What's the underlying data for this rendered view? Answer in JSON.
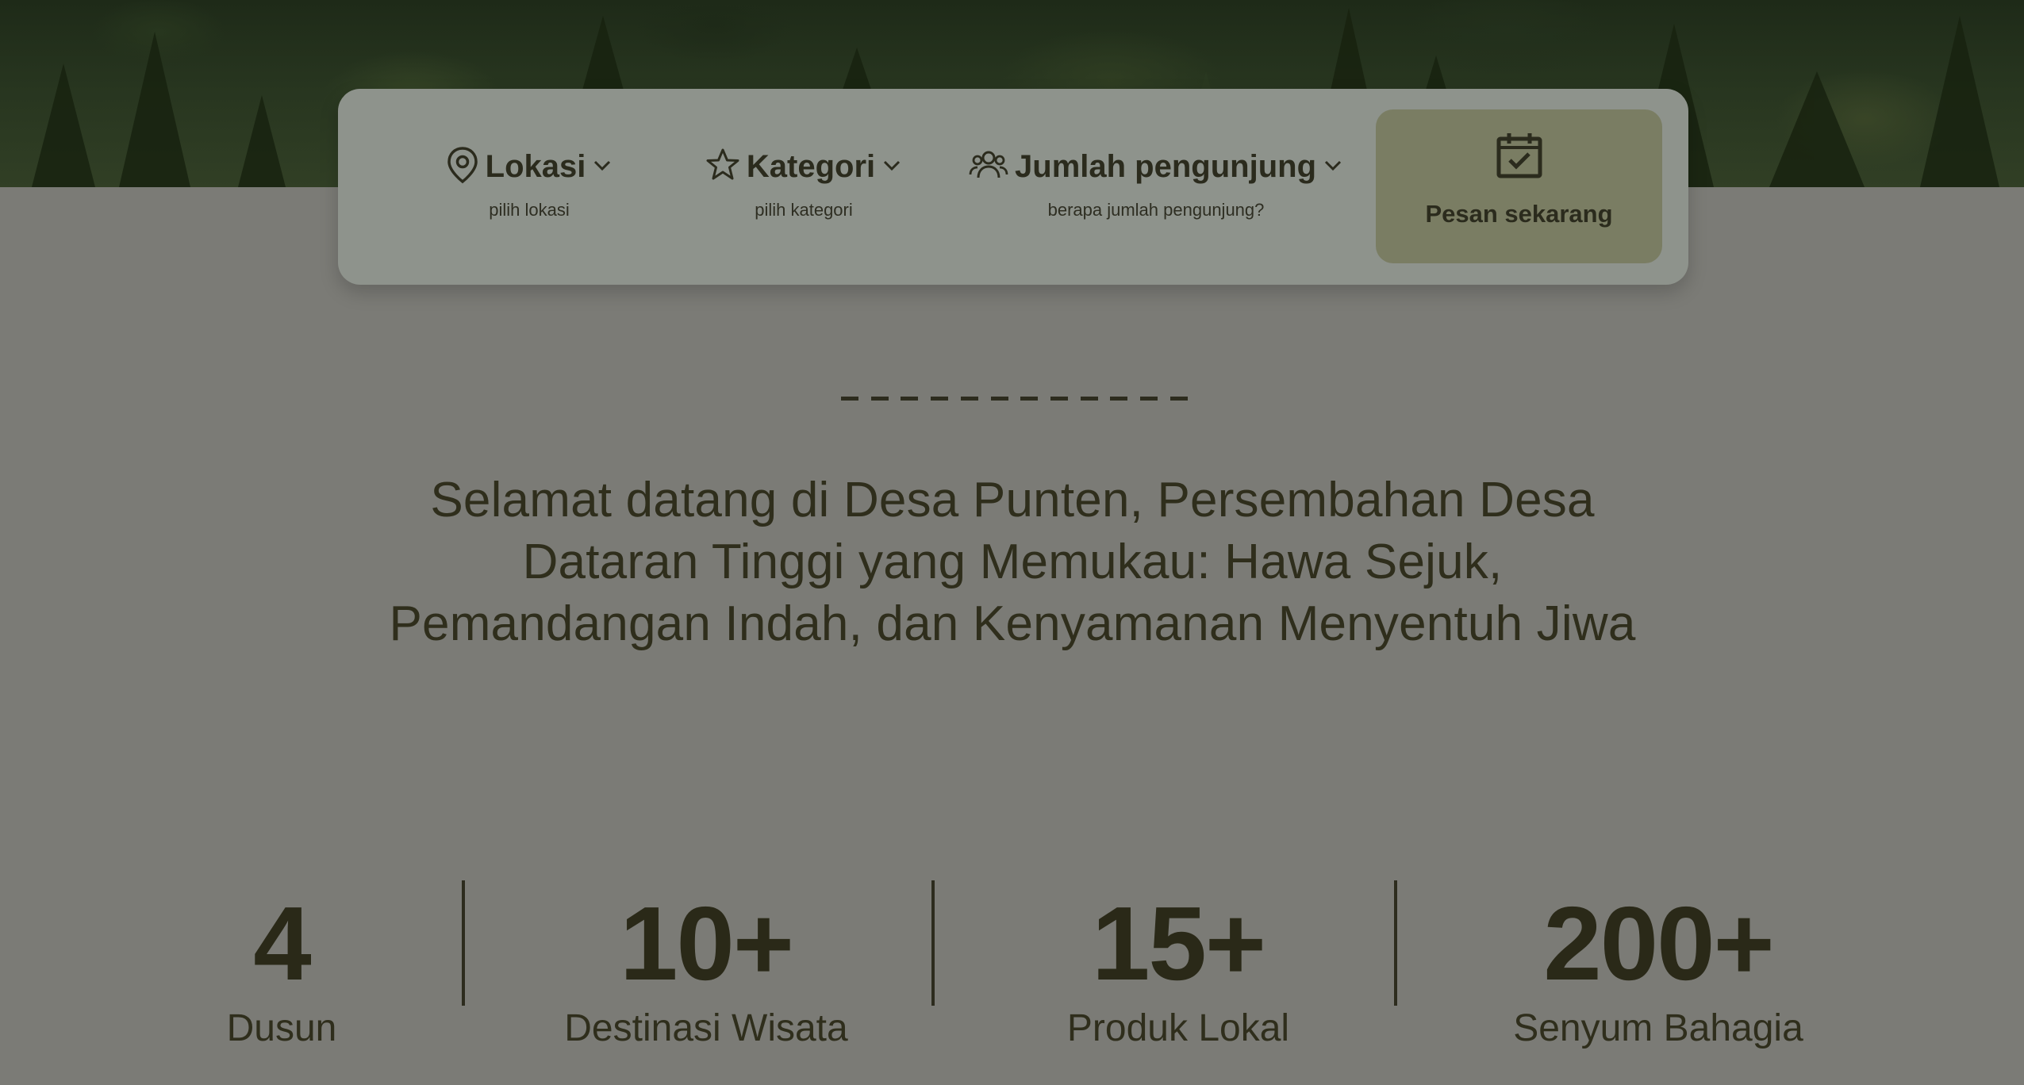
{
  "booking": {
    "filters": [
      {
        "label": "Lokasi",
        "sub": "pilih lokasi",
        "icon": "location-pin-icon"
      },
      {
        "label": "Kategori",
        "sub": "pilih kategori",
        "icon": "star-icon"
      },
      {
        "label": "Jumlah pengunjung",
        "sub": "berapa jumlah pengunjung?",
        "icon": "users-icon"
      }
    ],
    "button_label": "Pesan sekarang",
    "button_icon": "calendar-check-icon"
  },
  "intro": {
    "headline_lines": [
      "Selamat datang di Desa Punten, Persembahan Desa",
      "Dataran Tinggi yang Memukau: Hawa Sejuk,",
      "Pemandangan Indah, dan Kenyamanan Menyentuh Jiwa"
    ]
  },
  "stats": [
    {
      "value": "4",
      "label": "Dusun"
    },
    {
      "value": "10+",
      "label": "Destinasi Wisata"
    },
    {
      "value": "15+",
      "label": "Produk Lokal"
    },
    {
      "value": "200+",
      "label": "Senyum Bahagia"
    }
  ],
  "colors": {
    "page_background": "#7b7b76",
    "booking_bar": "#8e938c",
    "book_button": "#7a7d63",
    "text_dark": "#2f2e1c"
  }
}
